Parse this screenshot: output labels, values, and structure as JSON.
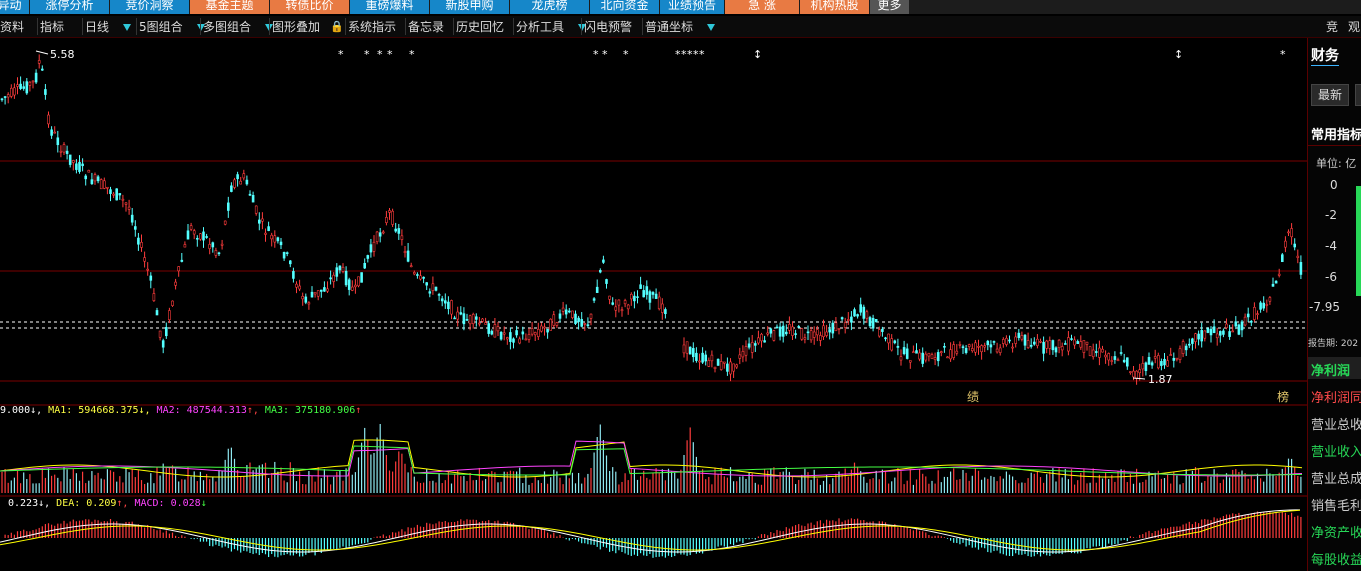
{
  "top_tabs": [
    {
      "label": "异动",
      "bg": "#1687c9"
    },
    {
      "label": "涨停分析",
      "bg": "#1687c9"
    },
    {
      "label": "竞价洞察",
      "bg": "#1687c9"
    },
    {
      "label": "基金主题",
      "bg": "#e87a43"
    },
    {
      "label": "转债比价",
      "bg": "#e87a43"
    },
    {
      "label": "重磅爆料",
      "bg": "#1687c9"
    },
    {
      "label": "新股申购",
      "bg": "#1687c9"
    },
    {
      "label": "龙虎榜",
      "bg": "#1687c9"
    },
    {
      "label": "北向资金",
      "bg": "#1687c9"
    },
    {
      "label": "业绩预告",
      "bg": "#1687c9"
    },
    {
      "label": "急 涨",
      "bg": "#e87a43"
    },
    {
      "label": "机构热股",
      "bg": "#e87a43"
    },
    {
      "label": "更多",
      "bg": "#555555"
    }
  ],
  "toolbar": {
    "items": [
      {
        "label": "资料",
        "dropdown": false
      },
      {
        "label": "指标",
        "dropdown": false
      },
      {
        "label": "日线",
        "dropdown": true
      },
      {
        "label": "5图组合",
        "dropdown": true
      },
      {
        "label": "多图组合",
        "dropdown": true
      },
      {
        "label": "图形叠加",
        "dropdown": false
      },
      {
        "label": "系统指示",
        "dropdown": false
      },
      {
        "label": "备忘录",
        "dropdown": false
      },
      {
        "label": "历史回忆",
        "dropdown": false
      },
      {
        "label": "分析工具",
        "dropdown": true
      },
      {
        "label": "闪电预警",
        "dropdown": false
      },
      {
        "label": "普通坐标",
        "dropdown": true
      }
    ],
    "right_items": [
      "竞",
      "观"
    ]
  },
  "main_chart": {
    "high_label": "5.58",
    "low_label": "1.87",
    "event_marks": [
      "绩",
      "榜"
    ]
  },
  "volume_indicator": {
    "vol_value": "9.000",
    "ma1": "MA1: 594668.375",
    "ma2": "MA2: 487544.313",
    "ma3": "MA3: 375180.906"
  },
  "macd_indicator": {
    "dif": "0.223",
    "dea": "DEA: 0.209",
    "macd": "MACD: 0.028"
  },
  "right_panel": {
    "title": "财务",
    "btn_latest": "最新",
    "common_title": "常用指标",
    "unit_label": "单位: 亿",
    "y_ticks": [
      "0",
      "-2",
      "-4",
      "-6",
      "-7.95"
    ],
    "report_label": "报告期: 202",
    "metrics": [
      {
        "label": "净利润",
        "color": "#27d857",
        "active": true
      },
      {
        "label": "净利润同",
        "color": "#ff4a4a",
        "active": false
      },
      {
        "label": "营业总收",
        "color": "#cccccc",
        "active": false
      },
      {
        "label": "营业收入",
        "color": "#27d857",
        "active": false
      },
      {
        "label": "营业总成",
        "color": "#cccccc",
        "active": false
      },
      {
        "label": "销售毛利",
        "color": "#cccccc",
        "active": false
      },
      {
        "label": "净资产收",
        "color": "#27d857",
        "active": false
      },
      {
        "label": "每股收益",
        "color": "#27d857",
        "active": false
      }
    ]
  },
  "colors": {
    "up": "#ff3c3c",
    "down": "#54ffff",
    "ma1": "#ffffff",
    "ma2": "#ff44ff",
    "ma3": "#44ff44",
    "ma_yellow": "#ffff00",
    "grid": "#7a0000"
  }
}
